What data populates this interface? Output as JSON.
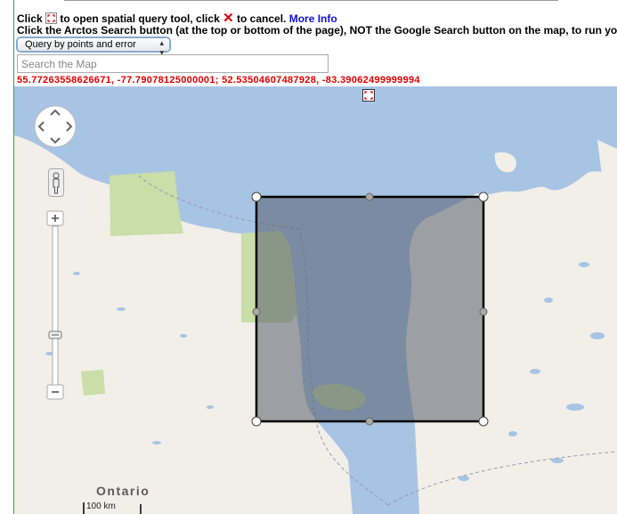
{
  "instructions": {
    "line1_pre": "Click",
    "line1_mid": "to open spatial query tool, click",
    "line1_post": "to cancel.",
    "more_info": "More Info",
    "line2": "Click the Arctos Search button (at the top or bottom of the page), NOT the Google Search button on the map, to run yo"
  },
  "query_select": {
    "selected": "Query by points and error"
  },
  "search": {
    "placeholder": "Search the Map",
    "value": ""
  },
  "coordinates": "55.77263558626671, -77.79078125000001; 52.53504607487928, -83.39062499999994",
  "map": {
    "place_label": "Ontario",
    "scale_label": "100 km",
    "colors": {
      "water": "#a8c4e4",
      "land": "#f2efe9",
      "park": "#c9dea8",
      "selection": "#555d6a"
    }
  }
}
